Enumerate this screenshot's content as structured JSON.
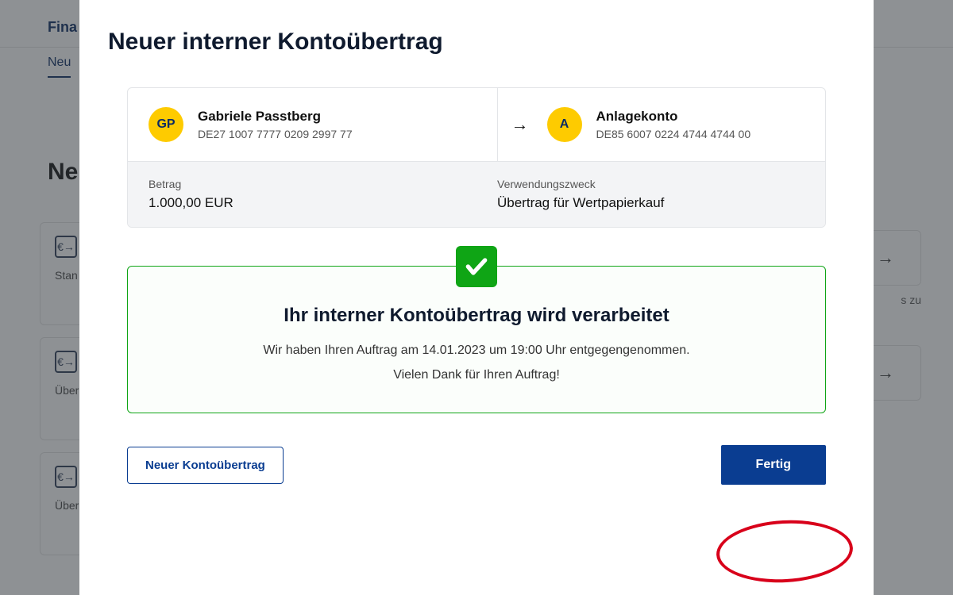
{
  "background": {
    "brand_partial": "Fina",
    "tab_partial": "Neu",
    "heading_partial": "Neu",
    "cards": [
      {
        "label": "Stan"
      },
      {
        "label": "Über"
      },
      {
        "label": "Über"
      }
    ],
    "right_caption_partial": "s zu"
  },
  "modal": {
    "title": "Neuer interner Kontoübertrag",
    "from": {
      "initials": "GP",
      "name": "Gabriele Passtberg",
      "iban": "DE27 1007 7777 0209 2997 77"
    },
    "to": {
      "initials": "A",
      "name": "Anlagekonto",
      "iban": "DE85 6007 0224 4744 4744 00"
    },
    "amount": {
      "label": "Betrag",
      "value": "1.000,00 EUR"
    },
    "purpose": {
      "label": "Verwendungszweck",
      "value": "Übertrag für Wertpapierkauf"
    },
    "success": {
      "title": "Ihr interner Kontoübertrag wird verarbeitet",
      "message": "Wir haben Ihren Auftrag am 14.01.2023 um 19:00 Uhr entgegengenommen.",
      "thanks": "Vielen Dank für Ihren Auftrag!"
    },
    "buttons": {
      "new_transfer": "Neuer Kontoübertrag",
      "done": "Fertig"
    }
  }
}
